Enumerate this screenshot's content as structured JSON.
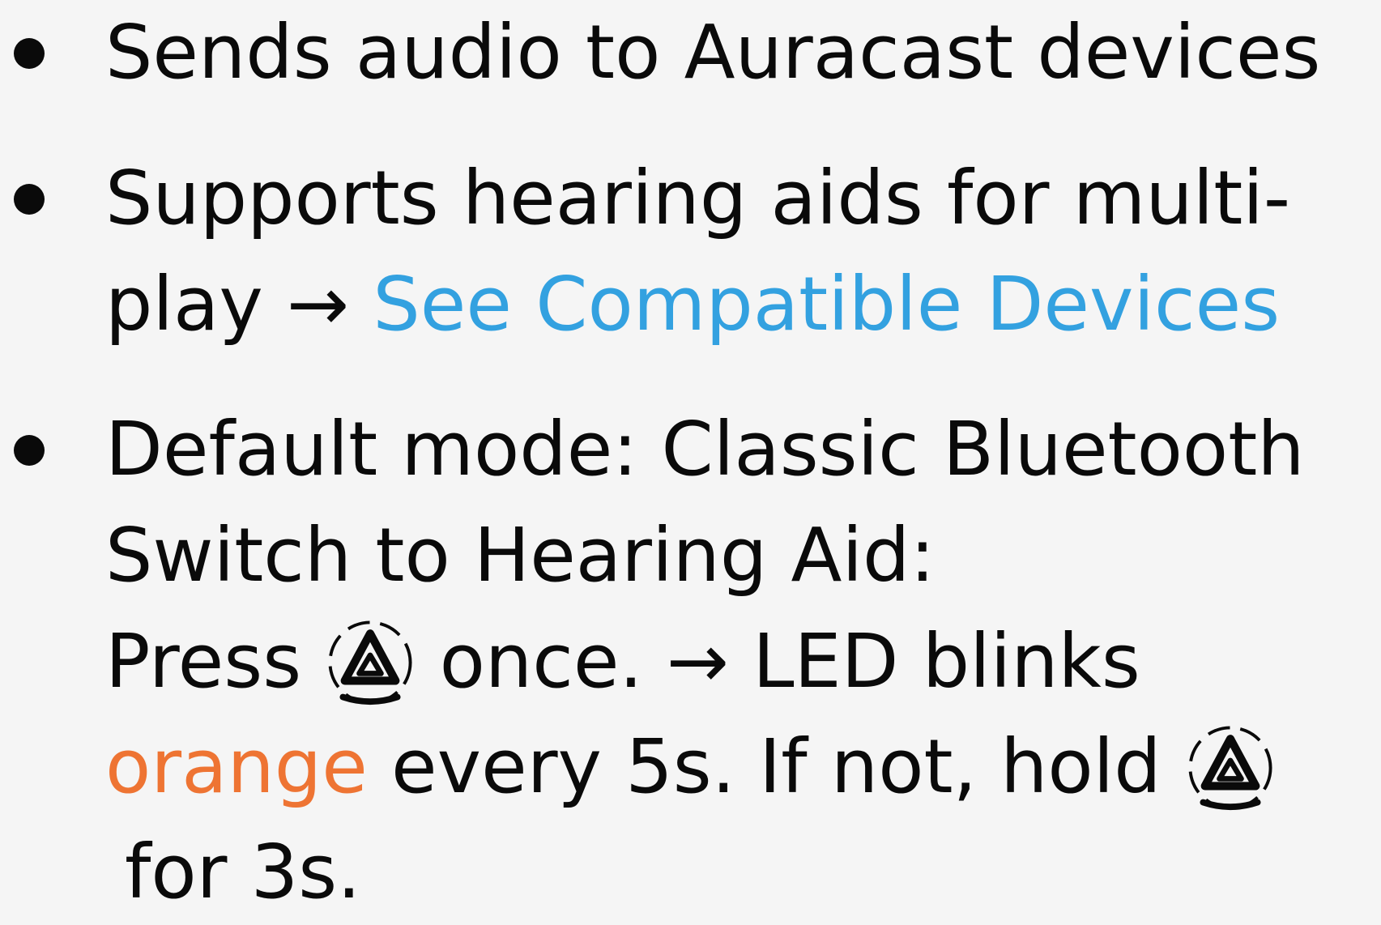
{
  "bullets": [
    {
      "lines": [
        "Sends audio to Auracast devices"
      ]
    },
    {
      "line1": "Supports hearing aids for multi-",
      "line2_prefix": "play →",
      "link_text": "See Compatible Devices"
    },
    {
      "line1": "Default mode: Classic Bluetooth",
      "line2": "Switch to Hearing Aid:",
      "line3_prefix": "Press",
      "line3_suffix": "once. → LED blinks",
      "line4_colored": "orange",
      "line4_rest": "every 5s. If not, hold",
      "line5": "for 3s."
    }
  ],
  "colors": {
    "link": "#33a1e0",
    "orange": "#ee7433",
    "text": "#0a0a0a",
    "background": "#f5f5f5"
  },
  "icons": {
    "button_icon": "auracast-button-icon"
  }
}
